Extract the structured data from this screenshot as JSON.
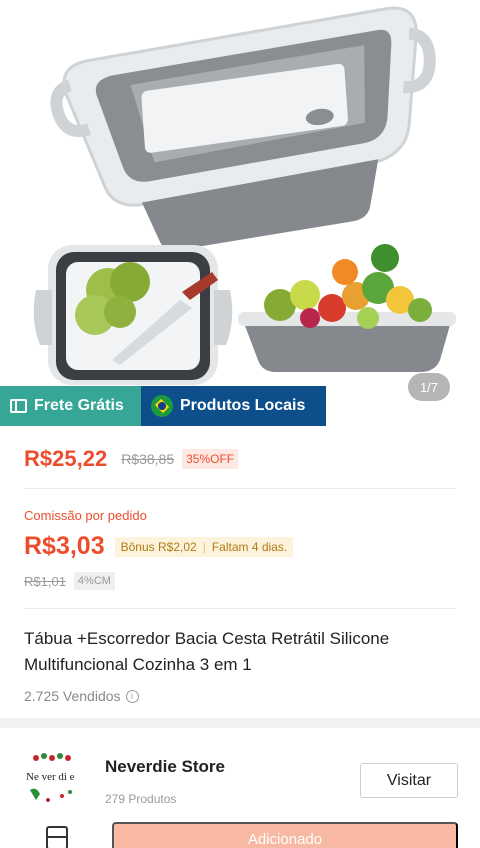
{
  "gallery": {
    "page_indicator": "1/7"
  },
  "badges": {
    "free_shipping": "Frete Grátis",
    "local_products": "Produtos Locais"
  },
  "pricing": {
    "price": "R$25,22",
    "original_price": "R$38,85",
    "discount": "35%OFF"
  },
  "commission": {
    "label": "Comissão por pedido",
    "value": "R$3,03",
    "bonus": "Bônus R$2,02",
    "remaining": "Faltam 4 dias.",
    "original": "R$1,01",
    "rate": "4%CM"
  },
  "product": {
    "title": "Tábua +Escorredor Bacia Cesta Retrátil Silicone Multifuncional Cozinha 3 em 1",
    "sold": "2.725 Vendidos"
  },
  "store": {
    "name": "Neverdie Store",
    "product_count": "279 Produtos",
    "visit_label": "Visitar",
    "logo_text": "Neverdie"
  },
  "bottom_bar": {
    "add_label": "Adicionado"
  },
  "colors": {
    "accent": "#ee4d2d",
    "free_shipping_bg": "#36a797",
    "local_bg": "#0d4f8a"
  }
}
